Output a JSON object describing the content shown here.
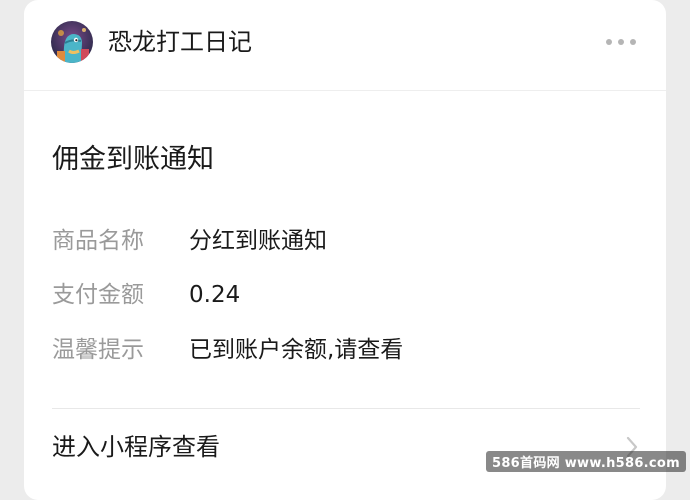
{
  "account": {
    "name": "恐龙打工日记",
    "avatar_icon": "dinosaur-avatar-icon"
  },
  "header": {
    "more_icon": "more-dots-icon"
  },
  "message": {
    "title": "佣金到账通知",
    "fields": [
      {
        "label": "商品名称",
        "value": "分红到账通知"
      },
      {
        "label": "支付金额",
        "value": "0.24"
      },
      {
        "label": "温馨提示",
        "value": "已到账户余额,请查看"
      }
    ]
  },
  "footer": {
    "open_label": "进入小程序查看",
    "chevron_icon": "chevron-right-icon"
  },
  "watermark": "586首码网 www.h586.com",
  "colors": {
    "background": "#ececec",
    "card": "#ffffff",
    "text_primary": "#1a1a1a",
    "text_secondary": "#9a9a9a"
  }
}
